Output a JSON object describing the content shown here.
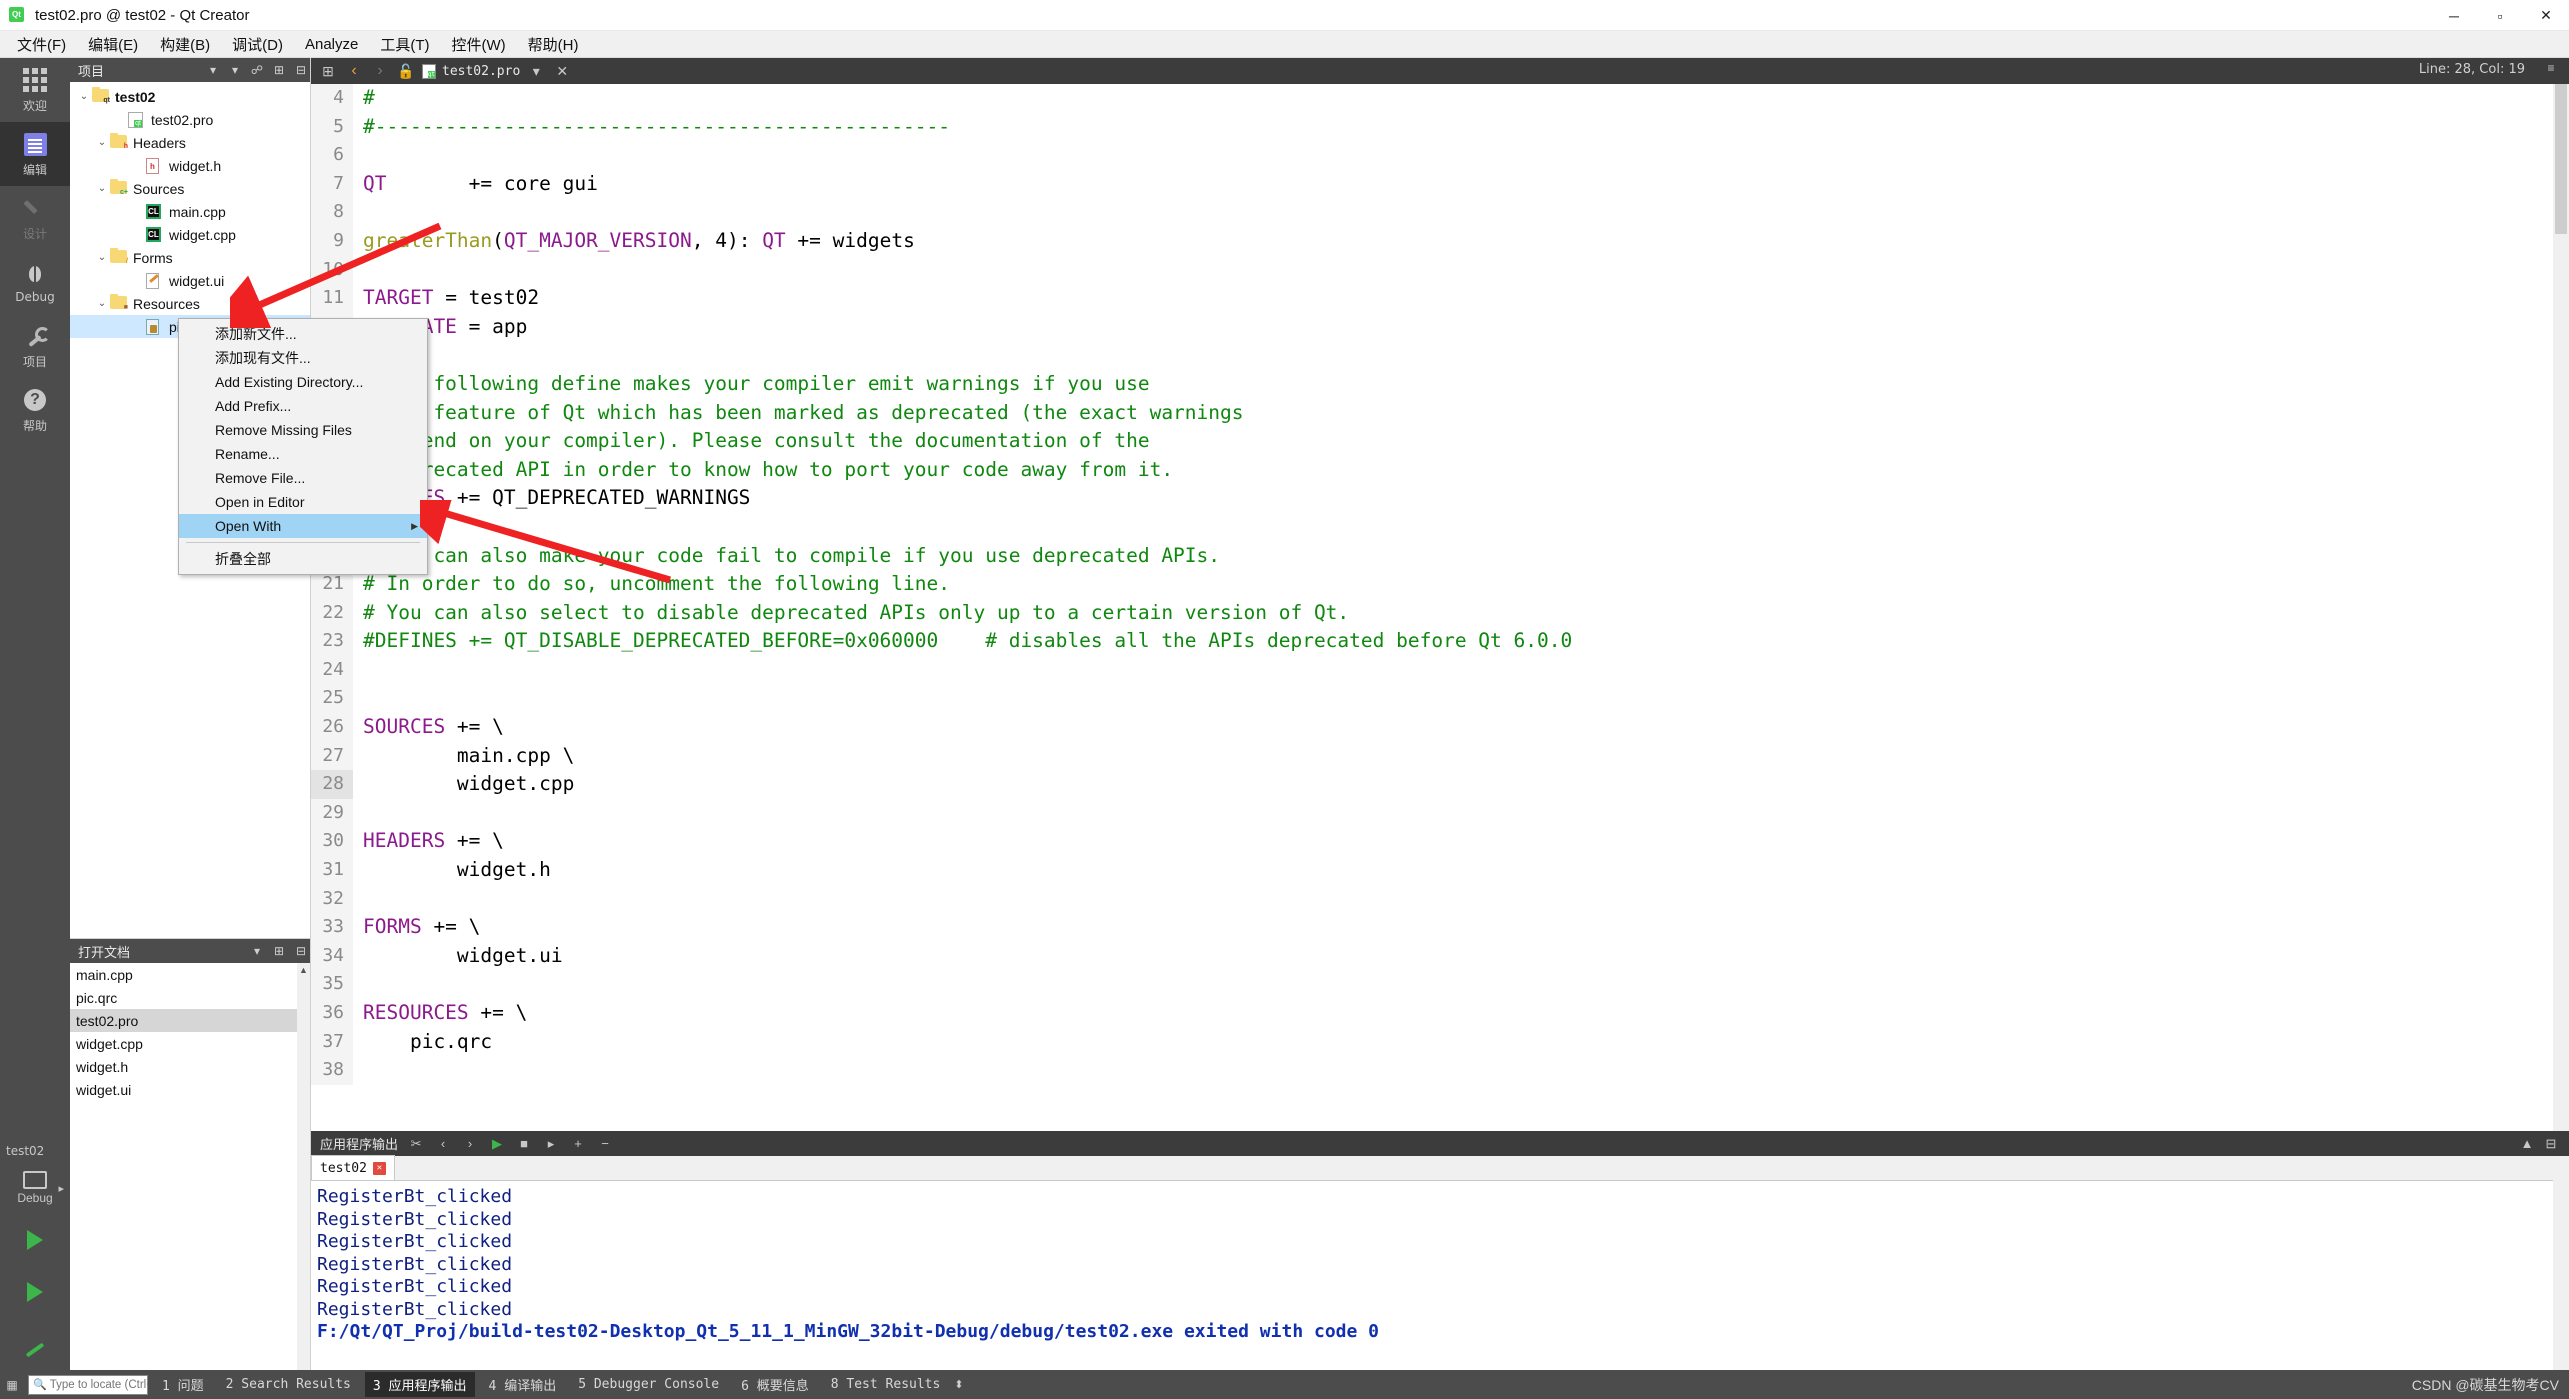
{
  "window": {
    "title": "test02.pro @ test02 - Qt Creator",
    "app_icon": "qt-logo-icon",
    "minimize": "─",
    "maximize": "▫",
    "close": "✕"
  },
  "menubar": [
    {
      "label": "文件(F)",
      "name": "menu-file"
    },
    {
      "label": "编辑(E)",
      "name": "menu-edit"
    },
    {
      "label": "构建(B)",
      "name": "menu-build"
    },
    {
      "label": "调试(D)",
      "name": "menu-debug"
    },
    {
      "label": "Analyze",
      "name": "menu-analyze"
    },
    {
      "label": "工具(T)",
      "name": "menu-tools"
    },
    {
      "label": "控件(W)",
      "name": "menu-window"
    },
    {
      "label": "帮助(H)",
      "name": "menu-help"
    }
  ],
  "activity_bar": {
    "items": [
      {
        "label": "欢迎",
        "icon": "grid-icon",
        "selected": false,
        "dim": false
      },
      {
        "label": "编辑",
        "icon": "document-lines-icon",
        "selected": true,
        "dim": false
      },
      {
        "label": "设计",
        "icon": "pencil-icon",
        "selected": false,
        "dim": true
      },
      {
        "label": "Debug",
        "icon": "bug-icon",
        "selected": false,
        "dim": false
      },
      {
        "label": "项目",
        "icon": "wrench-icon",
        "selected": false,
        "dim": false
      },
      {
        "label": "帮助",
        "icon": "question-mark-icon",
        "selected": false,
        "dim": false
      }
    ],
    "kit": {
      "project_name": "test02",
      "config_label": "Debug",
      "run_icon": "run-triangle-icon",
      "debug_icon": "debug-run-icon",
      "build_icon": "hammer-icon"
    }
  },
  "project_panel": {
    "title": "项目",
    "header_icons": [
      "chevron-down-icon",
      "filter-icon",
      "link-icon",
      "split-icon",
      "close-icon"
    ],
    "tree": [
      {
        "label": "test02",
        "indent": 0,
        "icon": "qt-project-folder-icon",
        "arrow": "⌄",
        "bold": true,
        "selected": false
      },
      {
        "label": "test02.pro",
        "indent": 2,
        "icon": "qt-pro-file-icon",
        "arrow": "",
        "bold": false,
        "selected": false
      },
      {
        "label": "Headers",
        "indent": 1,
        "icon": "folder-h-icon",
        "arrow": "⌄",
        "bold": false,
        "selected": false
      },
      {
        "label": "widget.h",
        "indent": 3,
        "icon": "header-file-icon",
        "arrow": "",
        "bold": false,
        "selected": false
      },
      {
        "label": "Sources",
        "indent": 1,
        "icon": "folder-cpp-icon",
        "arrow": "⌄",
        "bold": false,
        "selected": false
      },
      {
        "label": "main.cpp",
        "indent": 3,
        "icon": "cpp-file-icon",
        "arrow": "",
        "bold": false,
        "selected": false
      },
      {
        "label": "widget.cpp",
        "indent": 3,
        "icon": "cpp-file-icon",
        "arrow": "",
        "bold": false,
        "selected": false
      },
      {
        "label": "Forms",
        "indent": 1,
        "icon": "folder-forms-icon",
        "arrow": "⌄",
        "bold": false,
        "selected": false
      },
      {
        "label": "widget.ui",
        "indent": 3,
        "icon": "ui-file-icon",
        "arrow": "",
        "bold": false,
        "selected": false
      },
      {
        "label": "Resources",
        "indent": 1,
        "icon": "folder-resource-icon",
        "arrow": "⌄",
        "bold": false,
        "selected": false
      },
      {
        "label": "pic.qrc",
        "indent": 3,
        "icon": "qrc-file-icon",
        "arrow": "",
        "bold": false,
        "selected": true
      }
    ]
  },
  "context_menu": {
    "items": [
      {
        "label": "添加新文件...",
        "name": "ctx-add-new-file",
        "selected": false,
        "submenu": false
      },
      {
        "label": "添加现有文件...",
        "name": "ctx-add-existing-files",
        "selected": false,
        "submenu": false
      },
      {
        "label": "Add Existing Directory...",
        "name": "ctx-add-existing-directory",
        "selected": false,
        "submenu": false
      },
      {
        "label": "Add Prefix...",
        "name": "ctx-add-prefix",
        "selected": false,
        "submenu": false
      },
      {
        "label": "Remove Missing Files",
        "name": "ctx-remove-missing-files",
        "selected": false,
        "submenu": false
      },
      {
        "label": "Rename...",
        "name": "ctx-rename",
        "selected": false,
        "submenu": false
      },
      {
        "label": "Remove File...",
        "name": "ctx-remove-file",
        "selected": false,
        "submenu": false
      },
      {
        "label": "Open in Editor",
        "name": "ctx-open-in-editor",
        "selected": false,
        "submenu": false
      },
      {
        "label": "Open With",
        "name": "ctx-open-with",
        "selected": true,
        "submenu": true
      },
      {
        "label": "__SEP__",
        "name": "ctx-separator",
        "selected": false,
        "submenu": false
      },
      {
        "label": "折叠全部",
        "name": "ctx-collapse-all",
        "selected": false,
        "submenu": false
      }
    ],
    "submenu_arrow": "▶"
  },
  "open_documents": {
    "title": "打开文档",
    "header_icons": [
      "chevron-down-icon",
      "split-add-icon",
      "close-icon"
    ],
    "items": [
      {
        "label": "main.cpp",
        "selected": false
      },
      {
        "label": "pic.qrc",
        "selected": false
      },
      {
        "label": "test02.pro",
        "selected": true
      },
      {
        "label": "widget.cpp",
        "selected": false
      },
      {
        "label": "widget.h",
        "selected": false
      },
      {
        "label": "widget.ui",
        "selected": false
      }
    ]
  },
  "editor": {
    "toolbar": {
      "back_icon": "‹",
      "forward_icon": "›",
      "lock_icon": "unlock-icon",
      "file_icon": "qt-pro-file-icon",
      "filename": "test02.pro",
      "dropdown_icon": "▾",
      "close_icon": "✕",
      "split_icon": "split-icon"
    },
    "cursor_position": "Line: 28, Col: 19",
    "lines": [
      {
        "num": 4,
        "tokens": [
          {
            "t": "#",
            "c": "cm"
          }
        ]
      },
      {
        "num": 5,
        "tokens": [
          {
            "t": "#-------------------------------------------------",
            "c": "cm"
          }
        ]
      },
      {
        "num": 6,
        "tokens": []
      },
      {
        "num": 7,
        "tokens": [
          {
            "t": "QT",
            "c": "kw"
          },
          {
            "t": "       += core gui",
            "c": "op"
          }
        ]
      },
      {
        "num": 8,
        "tokens": []
      },
      {
        "num": 9,
        "tokens": [
          {
            "t": "greaterThan",
            "c": "fn"
          },
          {
            "t": "(",
            "c": "op"
          },
          {
            "t": "QT_MAJOR_VERSION",
            "c": "kw"
          },
          {
            "t": ", 4): ",
            "c": "op"
          },
          {
            "t": "QT",
            "c": "kw"
          },
          {
            "t": " += widgets",
            "c": "op"
          }
        ]
      },
      {
        "num": 10,
        "tokens": []
      },
      {
        "num": 11,
        "tokens": [
          {
            "t": "TARGET",
            "c": "kw"
          },
          {
            "t": " = test02",
            "c": "op"
          }
        ]
      },
      {
        "num": 12,
        "tokens": [
          {
            "t": "TEMPLATE",
            "c": "kw"
          },
          {
            "t": " = app",
            "c": "op"
          }
        ]
      },
      {
        "num": 13,
        "tokens": []
      },
      {
        "num": 14,
        "tokens": [
          {
            "t": "# The following define makes your compiler emit warnings if you use",
            "c": "cm"
          }
        ]
      },
      {
        "num": 15,
        "tokens": [
          {
            "t": "# any feature of Qt which has been marked as deprecated (the exact warnings",
            "c": "cm"
          }
        ]
      },
      {
        "num": 16,
        "tokens": [
          {
            "t": "# depend on your compiler). Please consult the documentation of the",
            "c": "cm"
          }
        ]
      },
      {
        "num": 17,
        "tokens": [
          {
            "t": "# deprecated API in order to know how to port your code away from it.",
            "c": "cm"
          }
        ]
      },
      {
        "num": 18,
        "tokens": [
          {
            "t": "DEFINES",
            "c": "kw"
          },
          {
            "t": " += QT_DEPRECATED_WARNINGS",
            "c": "op"
          }
        ]
      },
      {
        "num": 19,
        "tokens": []
      },
      {
        "num": 20,
        "tokens": [
          {
            "t": "# You can also make your code fail to compile if you use deprecated APIs.",
            "c": "cm"
          }
        ]
      },
      {
        "num": 21,
        "tokens": [
          {
            "t": "# In order to do so, uncomment the following line.",
            "c": "cm"
          }
        ]
      },
      {
        "num": 22,
        "tokens": [
          {
            "t": "# You can also select to disable deprecated APIs only up to a certain version of Qt.",
            "c": "cm"
          }
        ]
      },
      {
        "num": 23,
        "tokens": [
          {
            "t": "#DEFINES += QT_DISABLE_DEPRECATED_BEFORE=0x060000    # disables all the APIs deprecated before Qt 6.0.0",
            "c": "cm"
          }
        ]
      },
      {
        "num": 24,
        "tokens": []
      },
      {
        "num": 25,
        "tokens": []
      },
      {
        "num": 26,
        "tokens": [
          {
            "t": "SOURCES",
            "c": "kw"
          },
          {
            "t": " += \\",
            "c": "op"
          }
        ]
      },
      {
        "num": 27,
        "tokens": [
          {
            "t": "        main.cpp \\",
            "c": "op"
          }
        ]
      },
      {
        "num": 28,
        "tokens": [
          {
            "t": "        widget.cpp",
            "c": "op"
          }
        ]
      },
      {
        "num": 29,
        "tokens": []
      },
      {
        "num": 30,
        "tokens": [
          {
            "t": "HEADERS",
            "c": "kw"
          },
          {
            "t": " += \\",
            "c": "op"
          }
        ]
      },
      {
        "num": 31,
        "tokens": [
          {
            "t": "        widget.h",
            "c": "op"
          }
        ]
      },
      {
        "num": 32,
        "tokens": []
      },
      {
        "num": 33,
        "tokens": [
          {
            "t": "FORMS",
            "c": "kw"
          },
          {
            "t": " += \\",
            "c": "op"
          }
        ]
      },
      {
        "num": 34,
        "tokens": [
          {
            "t": "        widget.ui",
            "c": "op"
          }
        ]
      },
      {
        "num": 35,
        "tokens": []
      },
      {
        "num": 36,
        "tokens": [
          {
            "t": "RESOURCES",
            "c": "kw"
          },
          {
            "t": " += \\",
            "c": "op"
          }
        ]
      },
      {
        "num": 37,
        "tokens": [
          {
            "t": "    pic.qrc",
            "c": "op"
          }
        ]
      },
      {
        "num": 38,
        "tokens": []
      }
    ],
    "current_line": 28
  },
  "output_pane": {
    "title": "应用程序输出",
    "toolbar_icons": [
      "clear-icon",
      "prev-icon",
      "next-icon",
      "run-icon",
      "stop-icon",
      "attach-icon",
      "zoom-in-icon",
      "zoom-out-icon"
    ],
    "right_icons": [
      "maximize-icon",
      "close-icon"
    ],
    "tab": {
      "label": "test02",
      "close_badge": "✕"
    },
    "lines": [
      {
        "text": "RegisterBt_clicked",
        "bold": false
      },
      {
        "text": "RegisterBt_clicked",
        "bold": false
      },
      {
        "text": "RegisterBt_clicked",
        "bold": false
      },
      {
        "text": "RegisterBt_clicked",
        "bold": false
      },
      {
        "text": "RegisterBt_clicked",
        "bold": false
      },
      {
        "text": "RegisterBt_clicked",
        "bold": false
      },
      {
        "text": "F:/Qt/QT_Proj/build-test02-Desktop_Qt_5_11_1_MinGW_32bit-Debug/debug/test02.exe exited with code 0",
        "bold": true
      }
    ]
  },
  "status_bar": {
    "sidebar_toggle_icon": "sidebar-icon",
    "locator_placeholder": "Type to locate (Ctrl+...",
    "locator_value": "",
    "search_icon": "search-icon",
    "items": [
      {
        "label": "1 问题",
        "selected": false
      },
      {
        "label": "2 Search Results",
        "selected": false
      },
      {
        "label": "3 应用程序输出",
        "selected": true
      },
      {
        "label": "4 编译输出",
        "selected": false
      },
      {
        "label": "5 Debugger Console",
        "selected": false
      },
      {
        "label": "6 概要信息",
        "selected": false
      },
      {
        "label": "8 Test Results",
        "selected": false
      }
    ],
    "updown_icon": "⬍",
    "watermark": "CSDN @碳基生物考CV"
  },
  "colors": {
    "accent_selection": "#cde8ff",
    "menu_highlight": "#9fd4f5",
    "comment_green": "#108810",
    "keyword_purple": "#8c1a8c",
    "function_olive": "#9a9a1f",
    "qt_green": "#41cd52",
    "chrome_dark": "#4c4c4c",
    "annotation_red": "#ee2222"
  }
}
